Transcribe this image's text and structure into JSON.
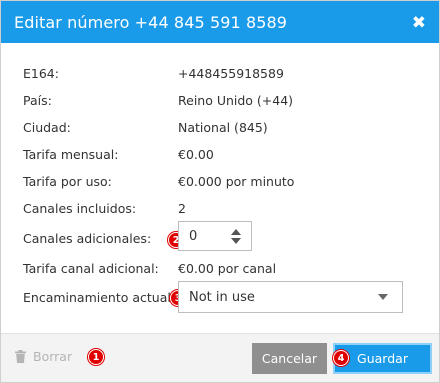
{
  "dialog": {
    "title": "Editar número +44 845 591 8589",
    "close_glyph": "✖"
  },
  "fields": {
    "e164": {
      "label": "E164:",
      "value": "+448455918589"
    },
    "pais": {
      "label": "País:",
      "value": "Reino Unido (+44)"
    },
    "ciudad": {
      "label": "Ciudad:",
      "value": "National (845)"
    },
    "tarifa_mensual": {
      "label": "Tarifa mensual:",
      "value": "€0.00"
    },
    "tarifa_uso": {
      "label": "Tarifa por uso:",
      "value": "€0.000 por minuto"
    },
    "canales_incluidos": {
      "label": "Canales incluidos:",
      "value": "2"
    },
    "canales_adicionales": {
      "label": "Canales adicionales:",
      "value": "0"
    },
    "tarifa_canal_adicional": {
      "label": "Tarifa canal adicional:",
      "value": "€0.00 por canal"
    },
    "encaminamiento": {
      "label": "Encaminamiento actual:",
      "value": "Not in use"
    }
  },
  "badges": {
    "one": "1",
    "two": "2",
    "three": "3",
    "four": "4"
  },
  "footer": {
    "delete_label": "Borrar",
    "cancel_label": "Cancelar",
    "save_label": "Guardar"
  },
  "colors": {
    "header": "#1a9bea",
    "badge": "#e00000",
    "cancel": "#8f8f8f",
    "save": "#1a9bea"
  },
  "icons": {
    "close": "close-icon",
    "trash": "trash-icon",
    "stepper_up": "chevron-up-icon",
    "stepper_down": "chevron-down-icon",
    "select_caret": "caret-down-icon"
  }
}
